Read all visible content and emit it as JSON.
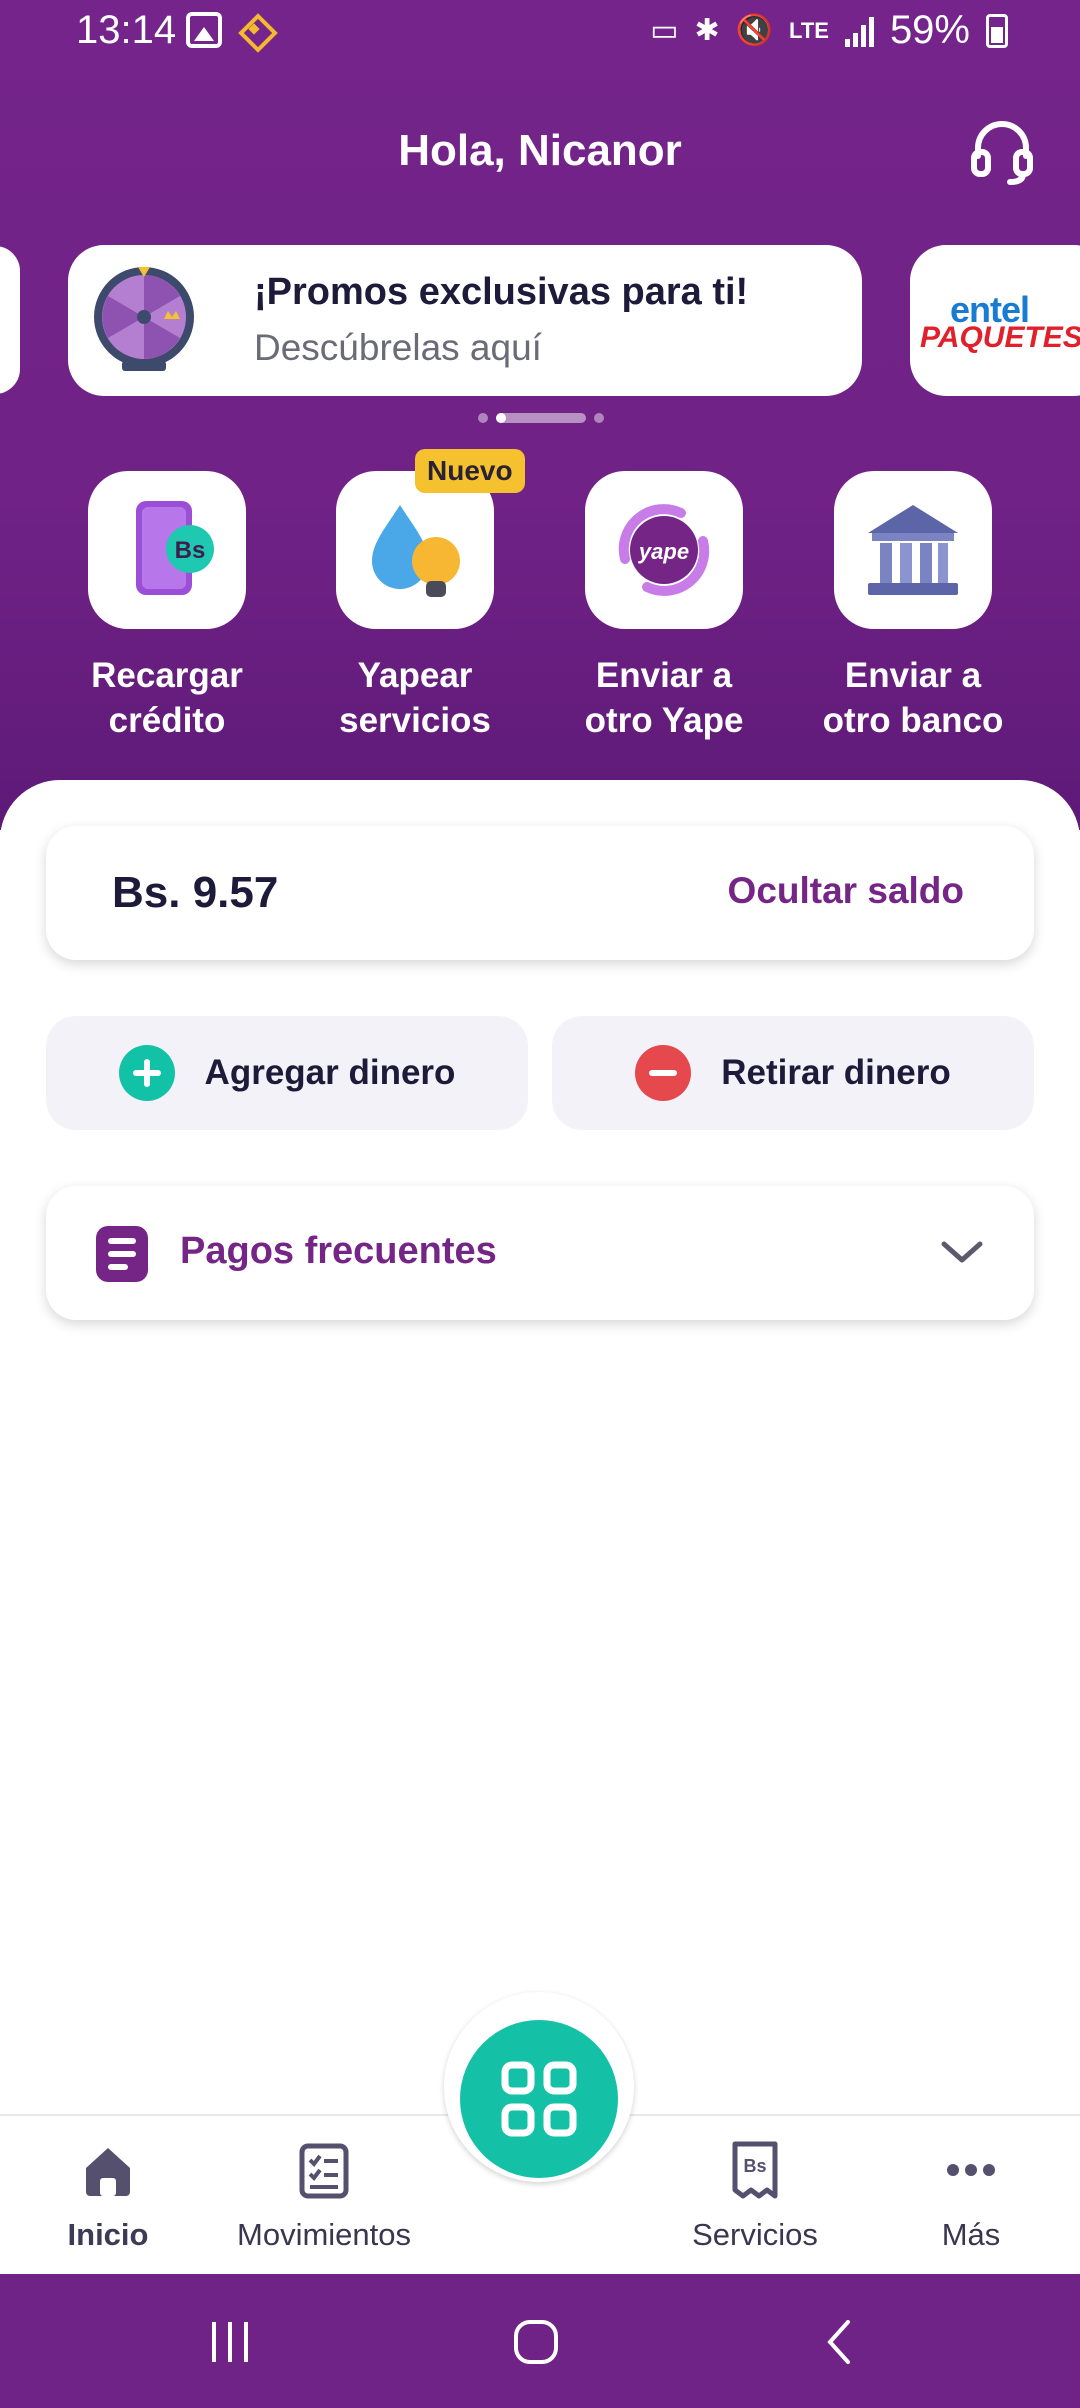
{
  "status_bar": {
    "time": "13:14",
    "battery": "59%",
    "network": "LTE"
  },
  "header": {
    "greeting": "Hola, Nicanor",
    "support_icon": "headset-icon"
  },
  "promos": {
    "card_title": "¡Promos exclusivas para ti!",
    "card_subtitle": "Descúbrelas aquí",
    "next_card_brand": "entel",
    "next_card_tag": "PAQUETES"
  },
  "actions": [
    {
      "label_line1": "Recargar",
      "label_line2": "crédito",
      "icon": "phone-recharge-icon"
    },
    {
      "label_line1": "Yapear",
      "label_line2": "servicios",
      "icon": "water-bulb-icon",
      "badge": "Nuevo"
    },
    {
      "label_line1": "Enviar a",
      "label_line2": "otro Yape",
      "icon": "yape-transfer-icon"
    },
    {
      "label_line1": "Enviar a",
      "label_line2": "otro banco",
      "icon": "bank-icon"
    }
  ],
  "balance": {
    "amount": "Bs. 9.57",
    "hide_label": "Ocultar saldo"
  },
  "money_actions": {
    "add_label": "Agregar dinero",
    "withdraw_label": "Retirar dinero"
  },
  "frequent": {
    "label": "Pagos frecuentes"
  },
  "bottom_nav": [
    {
      "label": "Inicio",
      "icon": "home-icon",
      "active": true
    },
    {
      "label": "Movimientos",
      "icon": "checklist-icon"
    },
    {
      "label": "Servicios",
      "icon": "receipt-icon"
    },
    {
      "label": "Más",
      "icon": "more-icon"
    }
  ],
  "colors": {
    "brand_purple": "#742586",
    "accent_teal": "#14c1a7",
    "badge_yellow": "#f5c12e",
    "danger_red": "#e5484d"
  }
}
